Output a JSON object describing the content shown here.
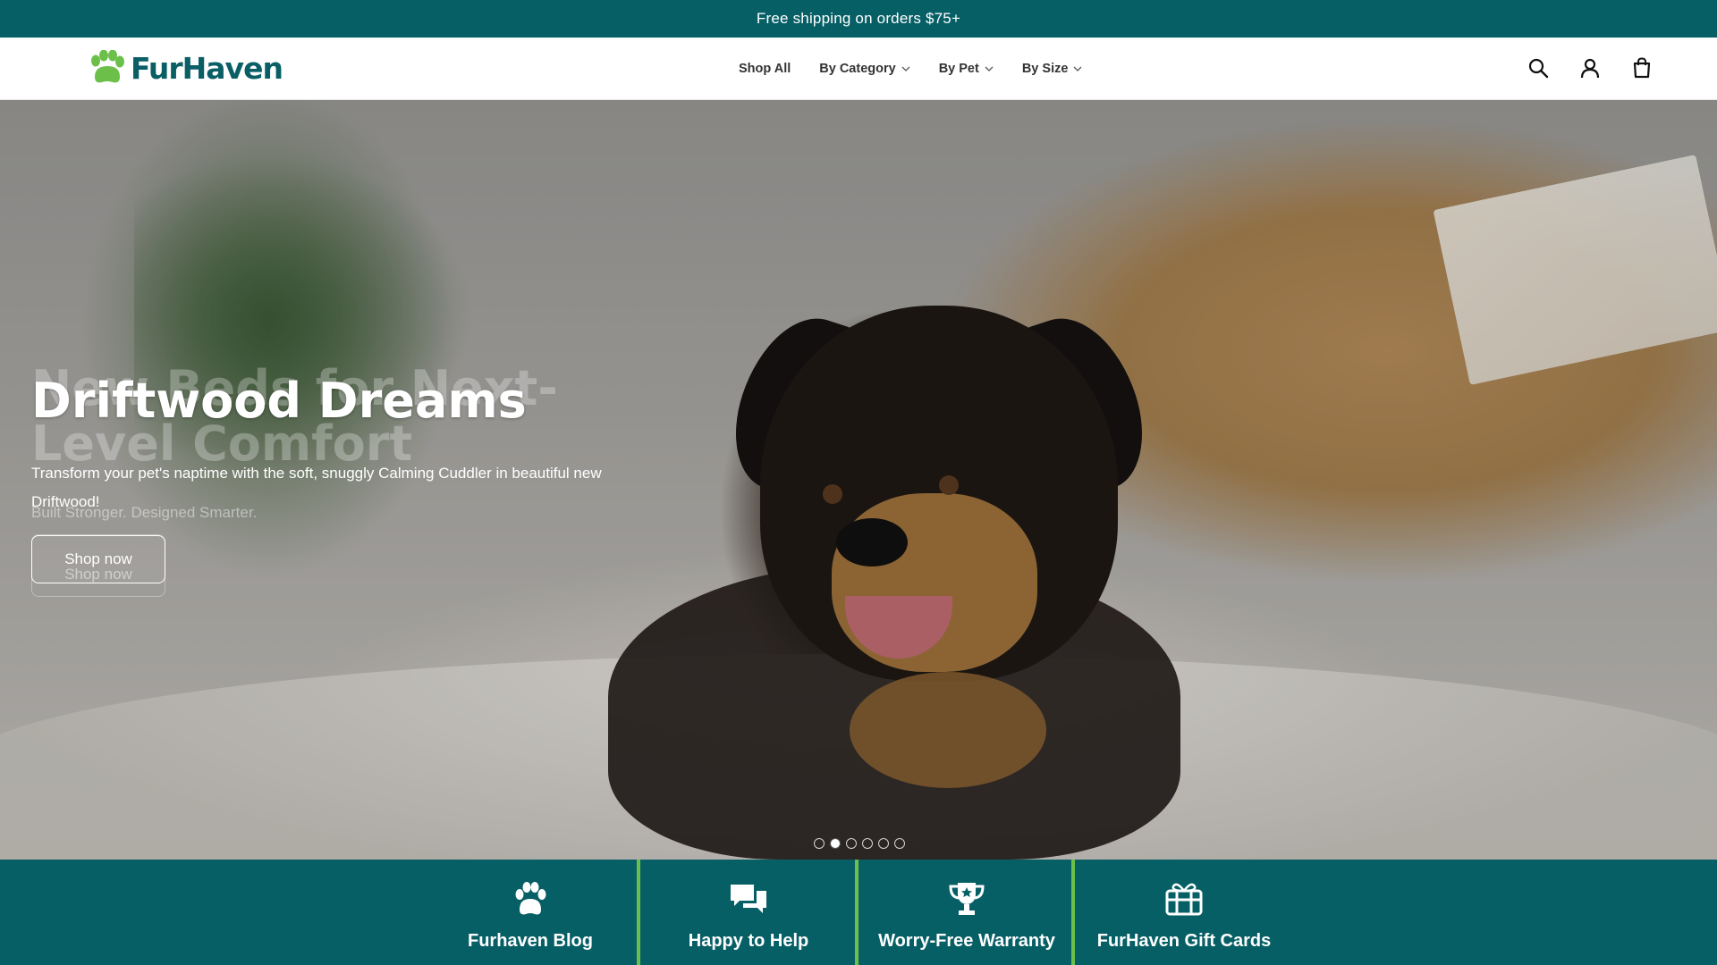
{
  "announcement": {
    "text": "Free shipping on orders $75+"
  },
  "brand": {
    "name": "FurHaven",
    "color": "#0a5f66",
    "accent": "#6cc04a"
  },
  "nav": {
    "items": [
      {
        "label": "Shop All"
      },
      {
        "label": "By Category"
      },
      {
        "label": "By Pet"
      },
      {
        "label": "By Size"
      }
    ]
  },
  "header_icons": [
    "search-icon",
    "account-icon",
    "cart-icon"
  ],
  "hero": {
    "ghost_title": "New Beds for Next-Level Comfort",
    "title": "Driftwood Dreams",
    "subtitle": "Transform your pet's naptime with the soft, snuggly Calming Cuddler in beautiful new Driftwood!",
    "ghost_subtitle": "Built Stronger. Designed Smarter.",
    "cta_label": "Shop now",
    "ghost_cta_label": "Shop now",
    "slides_total": 6,
    "active_slide": 2
  },
  "features": [
    {
      "label": "Furhaven Blog",
      "icon": "paw-icon"
    },
    {
      "label": "Happy to Help",
      "icon": "chat-bubbles-icon"
    },
    {
      "label": "Worry-Free Warranty",
      "icon": "trophy-icon"
    },
    {
      "label": "FurHaven Gift Cards",
      "icon": "gift-icon"
    }
  ]
}
